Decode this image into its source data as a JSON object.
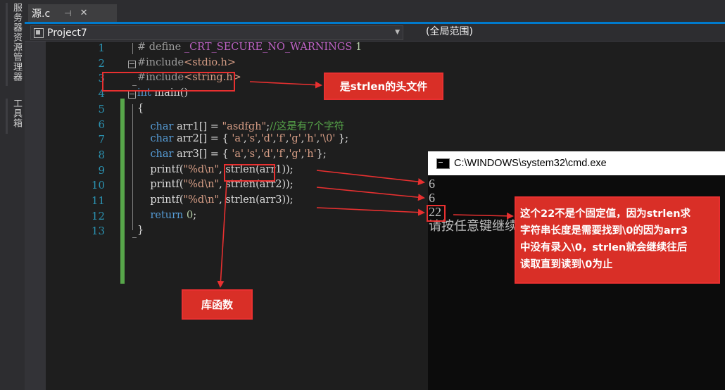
{
  "sidebar": {
    "tab1": "服务器资源管理器",
    "tab2": "工具箱"
  },
  "tab": {
    "name": "源.c",
    "pin_glyph": "⊣",
    "close_glyph": "✕"
  },
  "nav": {
    "project": "Project7",
    "scope": "(全局范围)"
  },
  "editor": {
    "lines": [
      {
        "num": "1",
        "parts": [
          {
            "t": "# define ",
            "c": "pp"
          },
          {
            "t": "_CRT_SECURE_NO_WARNINGS",
            "c": "macro"
          },
          {
            "t": " 1",
            "c": "num"
          }
        ]
      },
      {
        "num": "2",
        "parts": [
          {
            "t": "#include",
            "c": "pp"
          },
          {
            "t": "<stdio.h>",
            "c": "str"
          }
        ]
      },
      {
        "num": "3",
        "parts": [
          {
            "t": "#include",
            "c": "pp"
          },
          {
            "t": "<string.h>",
            "c": "str"
          }
        ]
      },
      {
        "num": "4",
        "parts": [
          {
            "t": "int",
            "c": "kw"
          },
          {
            "t": " main()",
            "c": ""
          }
        ]
      },
      {
        "num": "5",
        "parts": [
          {
            "t": "{",
            "c": ""
          }
        ]
      },
      {
        "num": "6",
        "parts": [
          {
            "t": "    ",
            "c": ""
          },
          {
            "t": "char",
            "c": "kw"
          },
          {
            "t": " arr1[] = ",
            "c": ""
          },
          {
            "t": "\"asdfgh\"",
            "c": "str"
          },
          {
            "t": ";",
            "c": ""
          },
          {
            "t": "//这是有7个字符",
            "c": "cm"
          }
        ]
      },
      {
        "num": "7",
        "parts": [
          {
            "t": "    ",
            "c": ""
          },
          {
            "t": "char",
            "c": "kw"
          },
          {
            "t": " arr2[] = { ",
            "c": ""
          },
          {
            "t": "'a'",
            "c": "str"
          },
          {
            "t": ",",
            "c": ""
          },
          {
            "t": "'s'",
            "c": "str"
          },
          {
            "t": ",",
            "c": ""
          },
          {
            "t": "'d'",
            "c": "str"
          },
          {
            "t": ",",
            "c": ""
          },
          {
            "t": "'f'",
            "c": "str"
          },
          {
            "t": ",",
            "c": ""
          },
          {
            "t": "'g'",
            "c": "str"
          },
          {
            "t": ",",
            "c": ""
          },
          {
            "t": "'h'",
            "c": "str"
          },
          {
            "t": ",",
            "c": ""
          },
          {
            "t": "'\\0'",
            "c": "str"
          },
          {
            "t": " };",
            "c": ""
          }
        ]
      },
      {
        "num": "8",
        "parts": [
          {
            "t": "    ",
            "c": ""
          },
          {
            "t": "char",
            "c": "kw"
          },
          {
            "t": " arr3[] = { ",
            "c": ""
          },
          {
            "t": "'a'",
            "c": "str"
          },
          {
            "t": ",",
            "c": ""
          },
          {
            "t": "'s'",
            "c": "str"
          },
          {
            "t": ",",
            "c": ""
          },
          {
            "t": "'d'",
            "c": "str"
          },
          {
            "t": ",",
            "c": ""
          },
          {
            "t": "'f'",
            "c": "str"
          },
          {
            "t": ",",
            "c": ""
          },
          {
            "t": "'g'",
            "c": "str"
          },
          {
            "t": ",",
            "c": ""
          },
          {
            "t": "'h'",
            "c": "str"
          },
          {
            "t": "};",
            "c": ""
          }
        ]
      },
      {
        "num": "9",
        "parts": [
          {
            "t": "    printf(",
            "c": ""
          },
          {
            "t": "\"%d\\n\"",
            "c": "str"
          },
          {
            "t": ", strlen(arr1));",
            "c": ""
          }
        ]
      },
      {
        "num": "10",
        "parts": [
          {
            "t": "    printf(",
            "c": ""
          },
          {
            "t": "\"%d\\n\"",
            "c": "str"
          },
          {
            "t": ", strlen(arr2));",
            "c": ""
          }
        ]
      },
      {
        "num": "11",
        "parts": [
          {
            "t": "    printf(",
            "c": ""
          },
          {
            "t": "\"%d\\n\"",
            "c": "str"
          },
          {
            "t": ", strlen(arr3));",
            "c": ""
          }
        ]
      },
      {
        "num": "12",
        "parts": [
          {
            "t": "    ",
            "c": ""
          },
          {
            "t": "return",
            "c": "kw"
          },
          {
            "t": " ",
            "c": ""
          },
          {
            "t": "0",
            "c": "num"
          },
          {
            "t": ";",
            "c": ""
          }
        ]
      },
      {
        "num": "13",
        "parts": [
          {
            "t": "}",
            "c": ""
          }
        ]
      }
    ]
  },
  "console": {
    "title": "C:\\WINDOWS\\system32\\cmd.exe",
    "output": [
      "6",
      "6",
      "22",
      "请按任意键继续"
    ]
  },
  "annotations": {
    "header_note": "是strlen的头文件",
    "library_note": "库函数",
    "explanation": [
      "这个22不是个固定值，因为strlen求",
      "字符串长度是需要找到\\0的因为arr3",
      "中没有录入\\0，strlen就会继续往后",
      "读取直到读到\\0为止"
    ]
  },
  "colors": {
    "annotation_red": "#e83030",
    "callout_fill": "#d92f27",
    "accent_blue": "#007acc"
  }
}
